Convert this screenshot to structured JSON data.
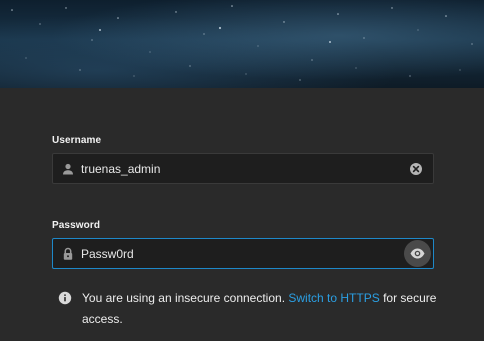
{
  "login": {
    "username": {
      "label": "Username",
      "value": "truenas_admin",
      "icon": "person-icon",
      "clear_icon": "clear-circle-icon"
    },
    "password": {
      "label": "Password",
      "value": "Passw0rd",
      "icon": "lock-icon",
      "toggle_icon": "eye-icon"
    },
    "notice": {
      "icon": "info-icon",
      "text_before": "You are using an insecure connection. ",
      "link_text": "Switch to HTTPS",
      "text_after": " for secure access."
    }
  },
  "colors": {
    "background": "#2a2a2a",
    "field_background": "#1e1e1e",
    "accent": "#1e88c8",
    "link": "#2b9fe3"
  }
}
